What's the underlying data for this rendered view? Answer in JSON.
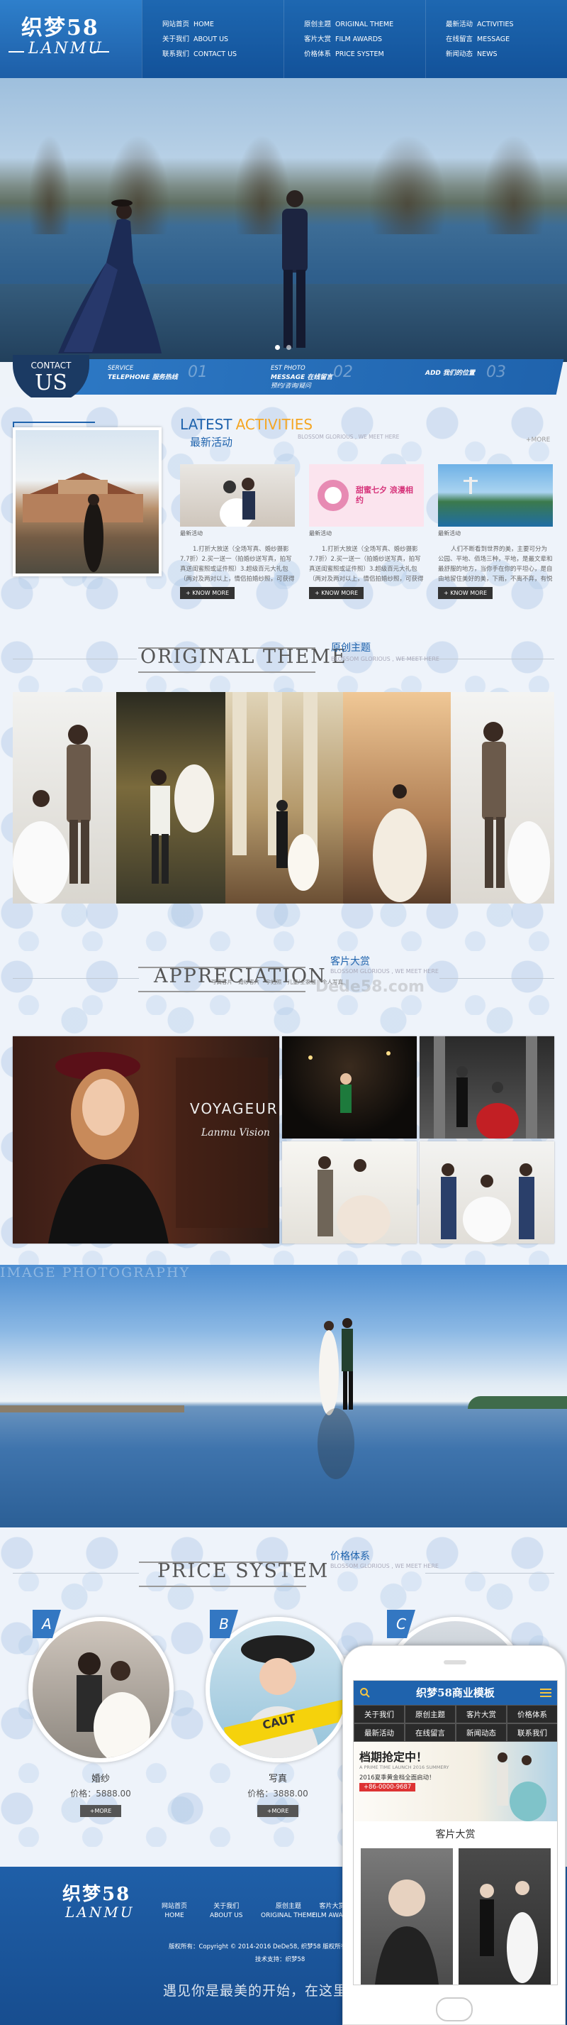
{
  "colors": {
    "brand": "#1f63ad",
    "accent": "#f5a623",
    "dark": "#333333"
  },
  "header": {
    "logo_cn": "织梦58",
    "logo_en": "LANMU",
    "nav": [
      [
        {
          "cn": "网站首页",
          "en": "HOME"
        },
        {
          "cn": "关于我们",
          "en": "ABOUT US"
        },
        {
          "cn": "联系我们",
          "en": "CONTACT US"
        }
      ],
      [
        {
          "cn": "原创主题",
          "en": "ORIGINAL THEME"
        },
        {
          "cn": "客片大赏",
          "en": "FILM AWARDS"
        },
        {
          "cn": "价格体系",
          "en": "PRICE SYSTEM"
        }
      ],
      [
        {
          "cn": "最新活动",
          "en": "ACTIVITIES"
        },
        {
          "cn": "在线留言",
          "en": "MESSAGE"
        },
        {
          "cn": "新闻动态",
          "en": "NEWS"
        }
      ]
    ]
  },
  "hero": {
    "slides": 2,
    "active_slide": 1
  },
  "contact": {
    "title": "CONTACT",
    "us": "US",
    "items": [
      {
        "en": "SERVICE",
        "label": "TELEPHONE 服务热线",
        "num": "01"
      },
      {
        "en": "EST PHOTO",
        "label": "MESSAGE 在线留言",
        "sub": "预约/咨询/疑问",
        "num": "02"
      },
      {
        "en": "",
        "label": "ADD 我们的位置",
        "num": "03"
      }
    ]
  },
  "activities": {
    "title_en_1": "LATEST",
    "title_en_2": "ACTIVITIES",
    "title_cn": "最新活动",
    "subtitle": "BLOSSOM GLORIOUS , WE MEET HERE",
    "more": "+MORE",
    "cards": [
      {
        "tag": "最新活动",
        "desc": "1.打折大放送（全场写真、婚纱摄影7.7折）2.买一送一（拍婚纱送写真，拍写真送闺蜜照或证件照）3.超级百元大礼包（两对及两对以上，情侣拍婚纱照，可获得额外一组拍摄套系，惠...",
        "button": "+ KNOW MORE"
      },
      {
        "tag": "最新活动",
        "desc": "1.打折大放送（全场写真、婚纱摄影7.7折）2.买一送一（拍婚纱送写真，拍写真送闺蜜照或证件照）3.超级百元大礼包（两对及两对以上，情侣拍婚纱照，可获得额外一组拍摄套系，惠...",
        "button": "+ KNOW MORE",
        "poster": "甜蜜七夕 浪漫相约"
      },
      {
        "tag": "最新活动",
        "desc": "人们不断看到世界的美，主要可分为公园、平地、佰场三种，平地，是最文辈和最舒服的地方，当你手在你的平坦心，是自由地留住美好的美，下雨，不离不弃，有悦于你的优秀的行不...",
        "button": "+ KNOW MORE"
      }
    ]
  },
  "original_theme": {
    "title": "ORIGINAL THEME",
    "cn": "原创主题",
    "sub": "BLOSSOM GLORIOUS , WE MEET HERE"
  },
  "appreciation": {
    "title": "APPRECIATION",
    "cn": "客片大赏",
    "sub": "BLOSSOM GLORIOUS , WE MEET HERE",
    "tabs": [
      "写真客片",
      "婚纱客片",
      "孕妇照",
      "儿童/全家福",
      "个人写真"
    ],
    "watermark": "Dede58.com",
    "voyageur": "VOYAGEUR",
    "voyageur_sub": "Lanmu Vision"
  },
  "lake": {
    "caption": "IMAGE PHOTOGRAPHY"
  },
  "price": {
    "title": "PRICE SYSTEM",
    "cn": "价格体系",
    "sub": "BLOSSOM GLORIOUS , WE MEET HERE",
    "items": [
      {
        "badge": "A",
        "name": "婚纱",
        "price": "价格：5888.00",
        "more": "+MORE"
      },
      {
        "badge": "B",
        "name": "写真",
        "price": "价格：3888.00",
        "more": "+MORE"
      },
      {
        "badge": "C",
        "name": "",
        "price": "",
        "more": ""
      }
    ],
    "caution": "CAUT"
  },
  "phone": {
    "title": "织梦58商业模板",
    "menu": [
      "关于我们",
      "原创主题",
      "客片大赏",
      "价格体系",
      "最新活动",
      "在线留言",
      "新闻动态",
      "联系我们"
    ],
    "banner_title": "档期抢定中！",
    "banner_sub": "A PRIME TIME LAUNCH 2016 SUMMERY",
    "banner_line": "2016夏季黄金档全面启动！",
    "banner_tel": "+86-0000-9687",
    "section": "客片大赏"
  },
  "footer": {
    "logo_cn": "织梦58",
    "logo_en": "LANMU",
    "nav": [
      {
        "cn": "网站首页",
        "en": "HOME"
      },
      {
        "cn": "关于我们",
        "en": "ABOUT US"
      },
      {
        "cn": "原创主题",
        "en": "ORIGINAL THEME"
      },
      {
        "cn": "客片大赏",
        "en": "FILM AWARD"
      }
    ],
    "copyright": "版权所有：Copyright © 2014-2016 DeDe58, 织梦58 版权所有",
    "tech": "技术支持：织梦58",
    "slogan": "遇见你是最美的开始，在这里见证"
  }
}
